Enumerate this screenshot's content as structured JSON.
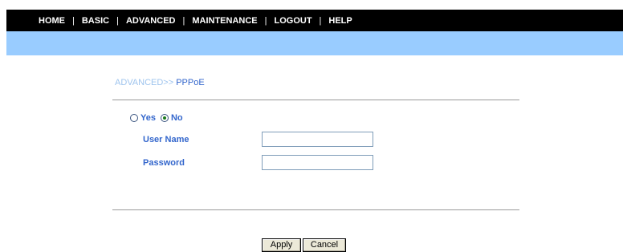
{
  "nav": {
    "items": [
      "HOME",
      "BASIC",
      "ADVANCED",
      "MAINTENANCE",
      "LOGOUT",
      "HELP"
    ],
    "separator": "|"
  },
  "breadcrumb": {
    "section": "ADVANCED>> ",
    "current": "PPPoE"
  },
  "pppoe": {
    "options": [
      "Yes",
      "No"
    ],
    "selected": "No",
    "username_label": "User Name",
    "password_label": "Password",
    "username_value": "",
    "password_value": ""
  },
  "buttons": {
    "apply": "Apply",
    "cancel": "Cancel"
  }
}
